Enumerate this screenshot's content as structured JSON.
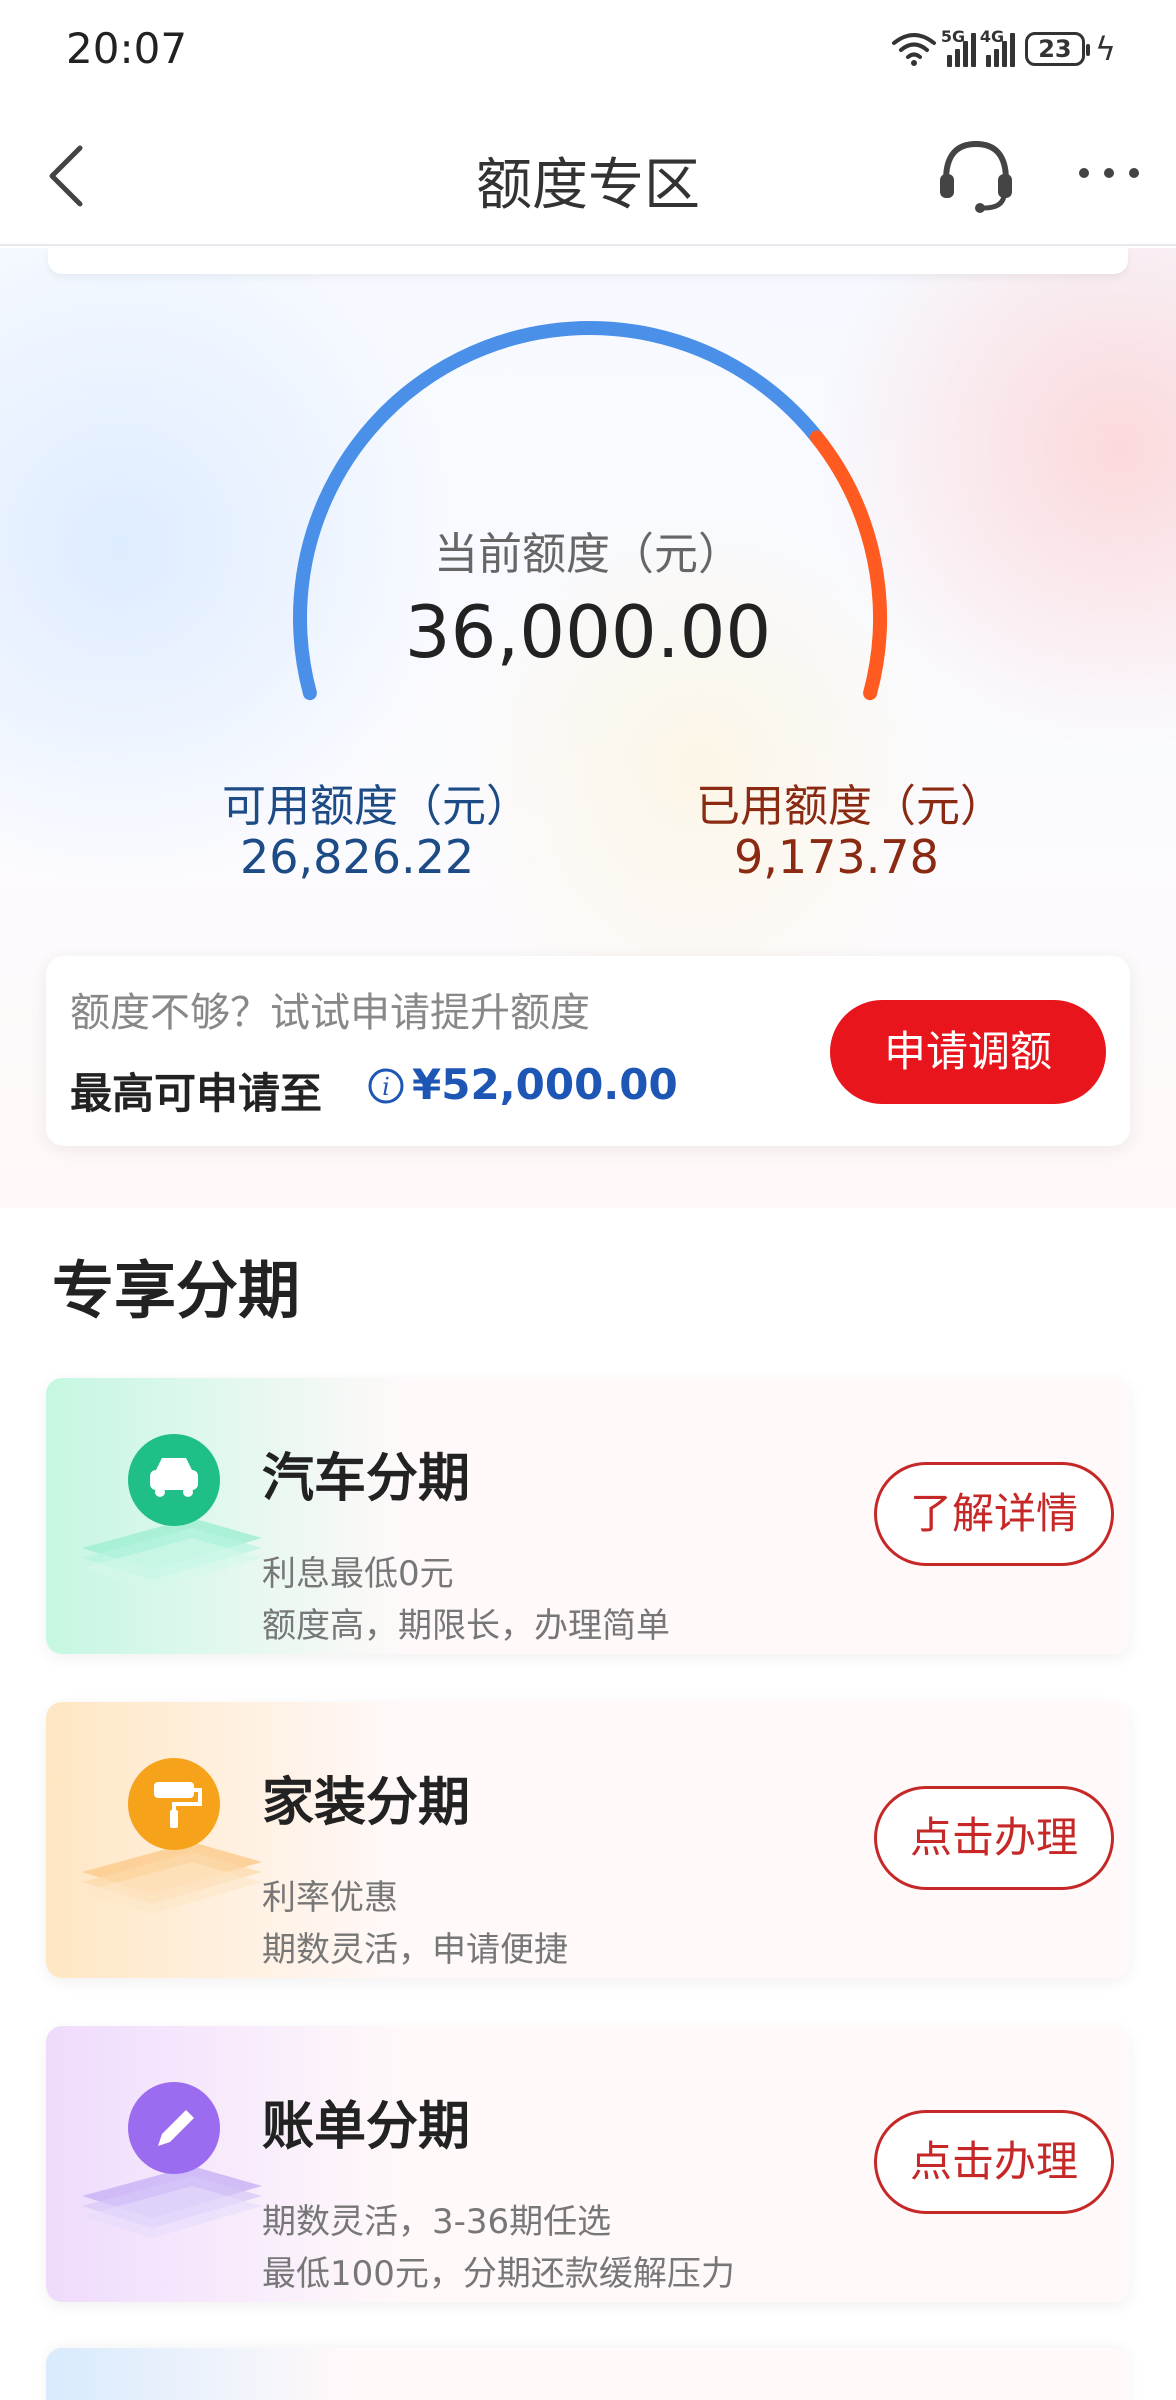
{
  "status_bar": {
    "time": "20:07",
    "battery": "23",
    "network_1": "5G",
    "network_2": "4G"
  },
  "nav": {
    "title": "额度专区",
    "back_icon": "chevron-left-icon",
    "support_icon": "headset-icon",
    "more_icon": "more-dots-icon"
  },
  "quota": {
    "current_label": "当前额度（元）",
    "current_value": "36,000.00",
    "available_label": "可用额度（元）",
    "available_value": "26,826.22",
    "used_label": "已用额度（元）",
    "used_value": "9,173.78",
    "used_fraction": 0.2548,
    "available_color": "#4a90e8",
    "used_color": "#ff5a1f"
  },
  "upgrade": {
    "prompt": "额度不够？试试申请提升额度",
    "max_label": "最高可申请至",
    "max_amount": "¥52,000.00",
    "apply_button": "申请调额",
    "button_color": "#e8161c"
  },
  "section": {
    "title": "专享分期"
  },
  "installments": [
    {
      "icon": "car-icon",
      "title": "汽车分期",
      "line1": "利息最低0元",
      "line2": "额度高，期限长，办理简单",
      "button": "了解详情",
      "accent": "#1fbf87"
    },
    {
      "icon": "paint-roller-icon",
      "title": "家装分期",
      "line1": "利率优惠",
      "line2": "期数灵活，申请便捷",
      "button": "点击办理",
      "accent": "#f7a21b"
    },
    {
      "icon": "pencil-icon",
      "title": "账单分期",
      "line1": "期数灵活，3-36期任选",
      "line2": "最低100元，分期还款缓解压力",
      "button": "点击办理",
      "accent": "#9b6cf0"
    }
  ]
}
